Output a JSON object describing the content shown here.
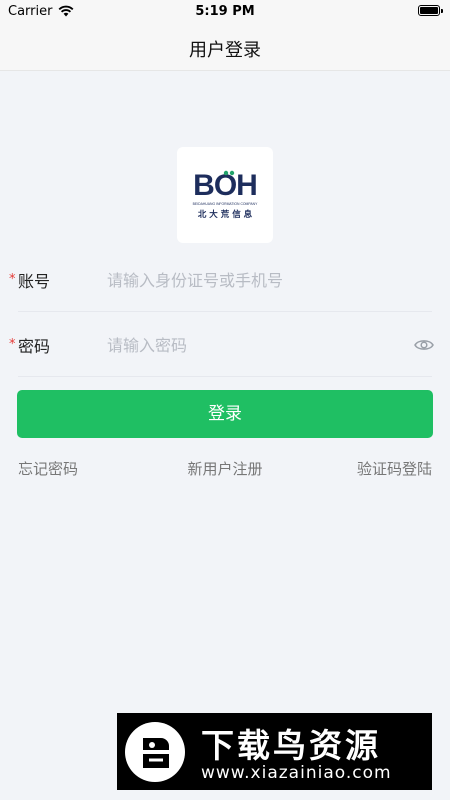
{
  "status_bar": {
    "carrier": "Carrier",
    "time": "5:19 PM",
    "battery_level": 1.0
  },
  "nav": {
    "title": "用户登录"
  },
  "logo": {
    "brand": "BOH",
    "subtitle_en": "BEIDAHUANG INFORMATION COMPANY",
    "subtitle_zh": "北 大 荒 信 息",
    "brand_color": "#1d2d5c",
    "accent_color": "#22a36a"
  },
  "form": {
    "account": {
      "required": "*",
      "label": "账号",
      "placeholder": "请输入身份证号或手机号",
      "value": ""
    },
    "password": {
      "required": "*",
      "label": "密码",
      "placeholder": "请输入密码",
      "value": "",
      "toggle_icon": "eye-icon"
    }
  },
  "login_button": {
    "label": "登录",
    "color": "#1fbf63"
  },
  "links": {
    "forgot": "忘记密码",
    "register": "新用户注册",
    "sms_login": "验证码登陆"
  },
  "watermark": {
    "title": "下载鸟资源",
    "url": "www.xiazainiao.com"
  }
}
